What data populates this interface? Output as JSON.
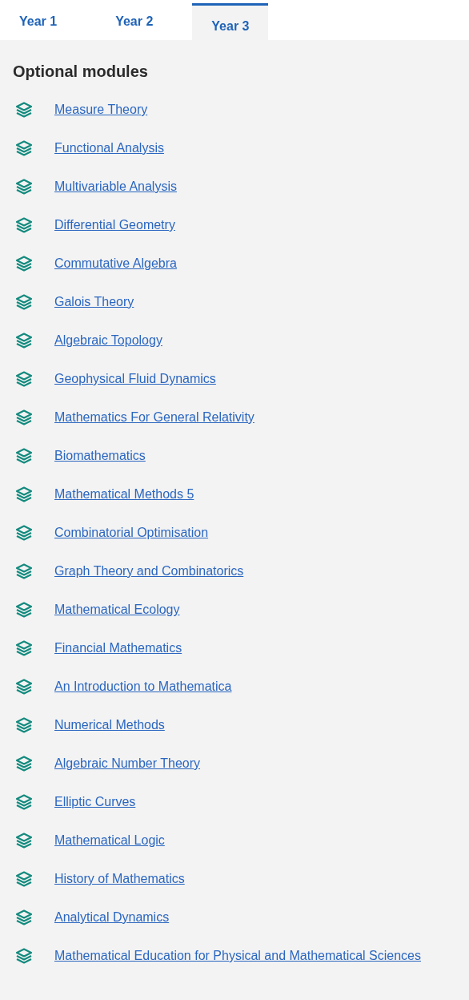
{
  "tabs": [
    {
      "label": "Year 1",
      "selected": false
    },
    {
      "label": "Year 2",
      "selected": false
    },
    {
      "label": "Year 3",
      "selected": true
    }
  ],
  "section": {
    "heading": "Optional modules",
    "modules": [
      "Measure Theory",
      "Functional Analysis",
      "Multivariable Analysis",
      "Differential Geometry",
      "Commutative Algebra",
      "Galois Theory",
      "Algebraic Topology",
      "Geophysical Fluid Dynamics",
      "Mathematics For General Relativity",
      "Biomathematics",
      "Mathematical Methods 5",
      "Combinatorial Optimisation",
      "Graph Theory and Combinatorics",
      "Mathematical Ecology",
      "Financial Mathematics",
      "An Introduction to Mathematica",
      "Numerical Methods",
      "Algebraic Number Theory",
      "Elliptic Curves",
      "Mathematical Logic",
      "History of Mathematics",
      "Analytical Dynamics",
      "Mathematical Education for Physical and Mathematical Sciences"
    ]
  }
}
